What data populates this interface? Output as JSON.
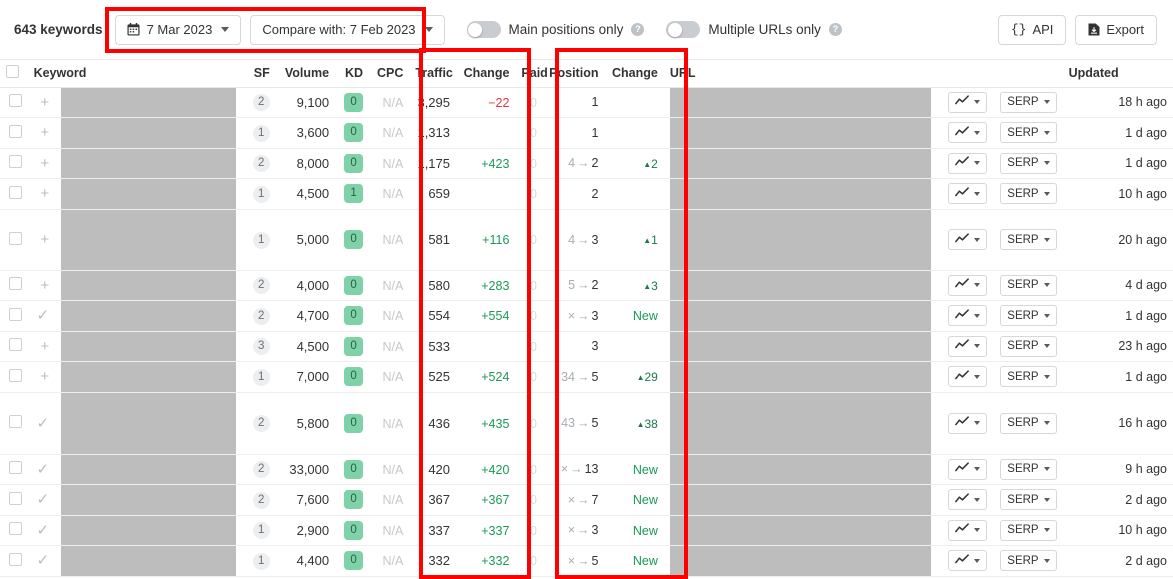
{
  "toolbar": {
    "keyword_count_label": "643 keywords",
    "date_picker": {
      "icon": "calendar-icon",
      "label": "7 Mar 2023"
    },
    "compare_picker": {
      "label": "Compare with: 7 Feb 2023"
    },
    "toggles": [
      {
        "label": "Main positions only",
        "help": "?",
        "on": false
      },
      {
        "label": "Multiple URLs only",
        "help": "?",
        "on": false
      }
    ],
    "api_button": {
      "icon": "braces-icon",
      "label": "API"
    },
    "export_button": {
      "icon": "download-icon",
      "label": "Export"
    }
  },
  "table": {
    "headers": {
      "keyword": "Keyword",
      "sf": "SF",
      "volume": "Volume",
      "kd": "KD",
      "cpc": "CPC",
      "traffic": "Traffic",
      "traffic_change": "Change",
      "paid": "Paid",
      "position": "Position",
      "position_change": "Change",
      "url": "URL",
      "updated": "Updated"
    },
    "row_action_labels": {
      "chart": "chart-icon",
      "serp": "SERP"
    },
    "rows": [
      {
        "add": "+",
        "keyword": "",
        "sf": "2",
        "volume": "9,100",
        "kd": "0",
        "cpc": "N/A",
        "traffic": "3,295",
        "traffic_change": "−22",
        "traffic_change_dir": "down",
        "paid": "0",
        "pos_old": "",
        "pos_new": "1",
        "pos_change": "",
        "pos_change_type": "none",
        "url": "",
        "serp": "SERP",
        "updated": "18 h ago",
        "height": "norm"
      },
      {
        "add": "+",
        "keyword": "",
        "sf": "1",
        "volume": "3,600",
        "kd": "0",
        "cpc": "N/A",
        "traffic": "1,313",
        "traffic_change": "",
        "traffic_change_dir": "none",
        "paid": "0",
        "pos_old": "",
        "pos_new": "1",
        "pos_change": "",
        "pos_change_type": "none",
        "url": "",
        "serp": "SERP",
        "updated": "1 d ago",
        "height": "norm"
      },
      {
        "add": "+",
        "keyword": "",
        "sf": "2",
        "volume": "8,000",
        "kd": "0",
        "cpc": "N/A",
        "traffic": "1,175",
        "traffic_change": "+423",
        "traffic_change_dir": "up",
        "paid": "0",
        "pos_old": "4",
        "pos_new": "2",
        "pos_change": "2",
        "pos_change_type": "up",
        "url": "",
        "serp": "SERP",
        "updated": "1 d ago",
        "height": "norm"
      },
      {
        "add": "+",
        "keyword": "",
        "sf": "1",
        "volume": "4,500",
        "kd": "1",
        "cpc": "N/A",
        "traffic": "659",
        "traffic_change": "",
        "traffic_change_dir": "none",
        "paid": "0",
        "pos_old": "",
        "pos_new": "2",
        "pos_change": "",
        "pos_change_type": "none",
        "url": "",
        "serp": "SERP",
        "updated": "10 h ago",
        "height": "norm"
      },
      {
        "add": "+",
        "keyword": "",
        "sf": "1",
        "volume": "5,000",
        "kd": "0",
        "cpc": "N/A",
        "traffic": "581",
        "traffic_change": "+116",
        "traffic_change_dir": "up",
        "paid": "0",
        "pos_old": "4",
        "pos_new": "3",
        "pos_change": "1",
        "pos_change_type": "up",
        "url": "",
        "serp": "SERP",
        "updated": "20 h ago",
        "height": "tall"
      },
      {
        "add": "+",
        "keyword": "",
        "sf": "2",
        "volume": "4,000",
        "kd": "0",
        "cpc": "N/A",
        "traffic": "580",
        "traffic_change": "+283",
        "traffic_change_dir": "up",
        "paid": "0",
        "pos_old": "5",
        "pos_new": "2",
        "pos_change": "3",
        "pos_change_type": "up",
        "url": "",
        "serp": "SERP",
        "updated": "4 d ago",
        "height": "norm"
      },
      {
        "add": "✓",
        "keyword": "",
        "sf": "2",
        "volume": "4,700",
        "kd": "0",
        "cpc": "N/A",
        "traffic": "554",
        "traffic_change": "+554",
        "traffic_change_dir": "up",
        "paid": "0",
        "pos_old": "×",
        "pos_new": "3",
        "pos_change": "New",
        "pos_change_type": "new",
        "url": "",
        "serp": "SERP",
        "updated": "1 d ago",
        "height": "norm"
      },
      {
        "add": "+",
        "keyword": "",
        "sf": "3",
        "volume": "4,500",
        "kd": "0",
        "cpc": "N/A",
        "traffic": "533",
        "traffic_change": "",
        "traffic_change_dir": "none",
        "paid": "0",
        "pos_old": "",
        "pos_new": "3",
        "pos_change": "",
        "pos_change_type": "none",
        "url": "",
        "serp": "SERP",
        "updated": "23 h ago",
        "height": "norm"
      },
      {
        "add": "+",
        "keyword": "",
        "sf": "1",
        "volume": "7,000",
        "kd": "0",
        "cpc": "N/A",
        "traffic": "525",
        "traffic_change": "+524",
        "traffic_change_dir": "up",
        "paid": "0",
        "pos_old": "34",
        "pos_new": "5",
        "pos_change": "29",
        "pos_change_type": "up",
        "url": "",
        "serp": "SERP",
        "updated": "1 d ago",
        "height": "norm"
      },
      {
        "add": "✓",
        "keyword": "",
        "sf": "2",
        "volume": "5,800",
        "kd": "0",
        "cpc": "N/A",
        "traffic": "436",
        "traffic_change": "+435",
        "traffic_change_dir": "up",
        "paid": "0",
        "pos_old": "43",
        "pos_new": "5",
        "pos_change": "38",
        "pos_change_type": "up",
        "url": "",
        "serp": "SERP",
        "updated": "16 h ago",
        "height": "xtall"
      },
      {
        "add": "✓",
        "keyword": "",
        "sf": "2",
        "volume": "33,000",
        "kd": "0",
        "cpc": "N/A",
        "traffic": "420",
        "traffic_change": "+420",
        "traffic_change_dir": "up",
        "paid": "0",
        "pos_old": "×",
        "pos_new": "13",
        "pos_change": "New",
        "pos_change_type": "new",
        "url": "",
        "serp": "SERP",
        "updated": "9 h ago",
        "height": "norm"
      },
      {
        "add": "✓",
        "keyword": "",
        "sf": "2",
        "volume": "7,600",
        "kd": "0",
        "cpc": "N/A",
        "traffic": "367",
        "traffic_change": "+367",
        "traffic_change_dir": "up",
        "paid": "0",
        "pos_old": "×",
        "pos_new": "7",
        "pos_change": "New",
        "pos_change_type": "new",
        "url": "",
        "serp": "SERP",
        "updated": "2 d ago",
        "height": "norm"
      },
      {
        "add": "✓",
        "keyword": "",
        "sf": "1",
        "volume": "2,900",
        "kd": "0",
        "cpc": "N/A",
        "traffic": "337",
        "traffic_change": "+337",
        "traffic_change_dir": "up",
        "paid": "0",
        "pos_old": "×",
        "pos_new": "3",
        "pos_change": "New",
        "pos_change_type": "new",
        "url": "",
        "serp": "SERP",
        "updated": "10 h ago",
        "height": "norm"
      },
      {
        "add": "✓",
        "keyword": "",
        "sf": "1",
        "volume": "4,400",
        "kd": "0",
        "cpc": "N/A",
        "traffic": "332",
        "traffic_change": "+332",
        "traffic_change_dir": "up",
        "paid": "0",
        "pos_old": "×",
        "pos_new": "5",
        "pos_change": "New",
        "pos_change_type": "new",
        "url": "",
        "serp": "SERP",
        "updated": "2 d ago",
        "height": "norm"
      }
    ]
  },
  "annotations": {
    "boxes": [
      {
        "name": "date-range-highlight",
        "color": "#ff0000"
      },
      {
        "name": "traffic-columns-highlight",
        "color": "#ff0000"
      },
      {
        "name": "position-columns-highlight",
        "color": "#ff0000"
      }
    ]
  },
  "colors": {
    "annotation": "#ff0000",
    "gain": "#1a9a54",
    "loss": "#e8353d",
    "kd_badge_bg": "#7fd1a7",
    "redaction": "#bdbdbd"
  }
}
